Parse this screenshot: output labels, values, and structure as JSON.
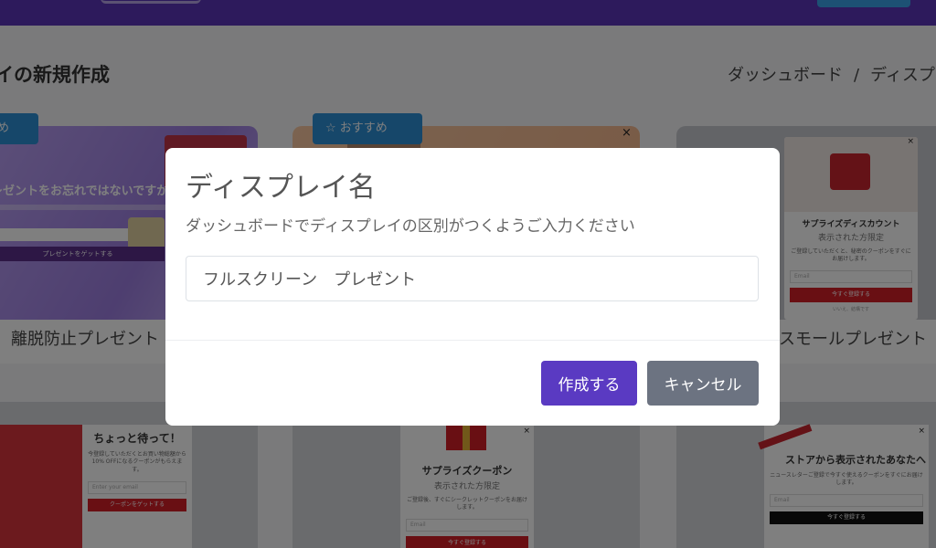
{
  "page": {
    "title": "イの新規作成",
    "breadcrumb": {
      "dashboard": "ダッシュボード",
      "separator": "/",
      "current": "ディスプレ"
    }
  },
  "templates": [
    {
      "badge": "すめ",
      "label": "離脱防止プレゼント",
      "preview": {
        "headline": "レゼントをお忘れではないですか",
        "button": "プレゼントをゲットする"
      }
    },
    {
      "badge": "☆ おすすめ",
      "label": "",
      "preview": {
        "close": "×"
      }
    },
    {
      "badge": "",
      "label": "スモールプレゼント",
      "preview": {
        "title": "サプライズディスカウント",
        "subtitle": "表示された方限定",
        "desc": "ご登録していただくと、秘密のクーポンをすぐにお届けします。",
        "email": "Email",
        "button": "今すぐ登録する",
        "small": "いいえ、結構です",
        "close": "×"
      }
    }
  ],
  "templates_row2": [
    {
      "title": "ちょっと待って！",
      "desc": "今登録していただくとお買い物総額から 10% OFFになるクーポンがもらえます。",
      "email": "Enter your email",
      "button": "クーポンをゲットする"
    },
    {
      "title": "サプライズクーポン",
      "subtitle": "表示された方限定",
      "desc": "ご登録後、すぐにシークレットクーポンをお届けします。",
      "email": "Email",
      "button": "今すぐ登録する",
      "close": "×"
    },
    {
      "title": "ストアから表示されたあなたへ",
      "desc": "ニュースレターご登録で今すぐ使えるクーポンをすぐにお届けします。",
      "email": "Email",
      "button": "今すぐ登録する",
      "close": "×"
    }
  ],
  "modal": {
    "title": "ディスプレイ名",
    "description": "ダッシュボードでディスプレイの区別がつくようご入力ください",
    "input_value": "フルスクリーン　プレゼント",
    "create_button": "作成する",
    "cancel_button": "キャンセル"
  },
  "colors": {
    "primary": "#5a3ac2",
    "secondary": "#6c7381",
    "header": "#5a34b8",
    "badge": "#2d8fd5"
  }
}
